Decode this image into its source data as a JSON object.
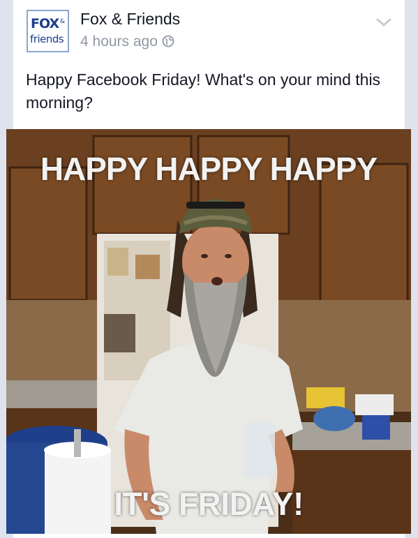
{
  "post": {
    "page_name": "Fox & Friends",
    "time": "4 hours ago",
    "text": "Happy Facebook Friday! What's on your mind this morning?"
  },
  "logo": {
    "line1": "FOX",
    "amp": "&",
    "line2": "friends"
  },
  "photo": {
    "caption_top": "HAPPY HAPPY HAPPY",
    "caption_bottom": "IT'S FRIDAY!"
  },
  "icons": {
    "privacy": "globe-icon",
    "options": "chevron-down-icon"
  },
  "colors": {
    "name_text": "#141823",
    "meta_text": "#9197a3",
    "logo_blue": "#1c3e8c"
  }
}
